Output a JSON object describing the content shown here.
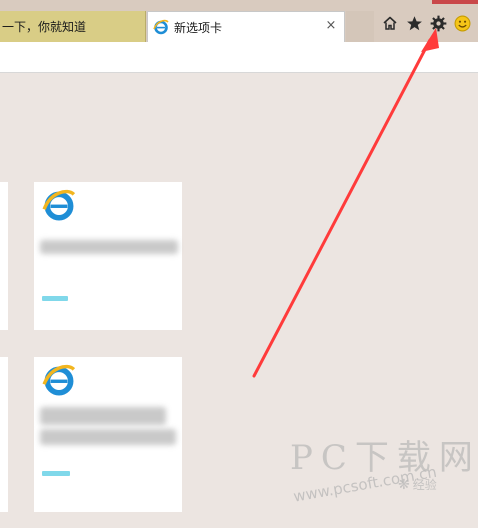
{
  "tabs": [
    {
      "label": "一下，你就知道",
      "active": false
    },
    {
      "label": "新选项卡",
      "active": true,
      "close": "×"
    }
  ],
  "toolbar": {
    "icons": [
      "home-icon",
      "favorites-star-icon",
      "settings-gear-icon",
      "feedback-smiley-icon"
    ]
  },
  "tiles": [
    {
      "icon": "ie-icon"
    },
    {
      "icon": "ie-icon"
    }
  ],
  "watermark": {
    "brand": "PC下载网",
    "url": "www.pcsoft.com.cn",
    "badge": "经验"
  },
  "colors": {
    "accent_arrow": "#ff3b3b",
    "inactive_tab": "#d9cd86",
    "tile_label_bar": "#80d8ea"
  }
}
